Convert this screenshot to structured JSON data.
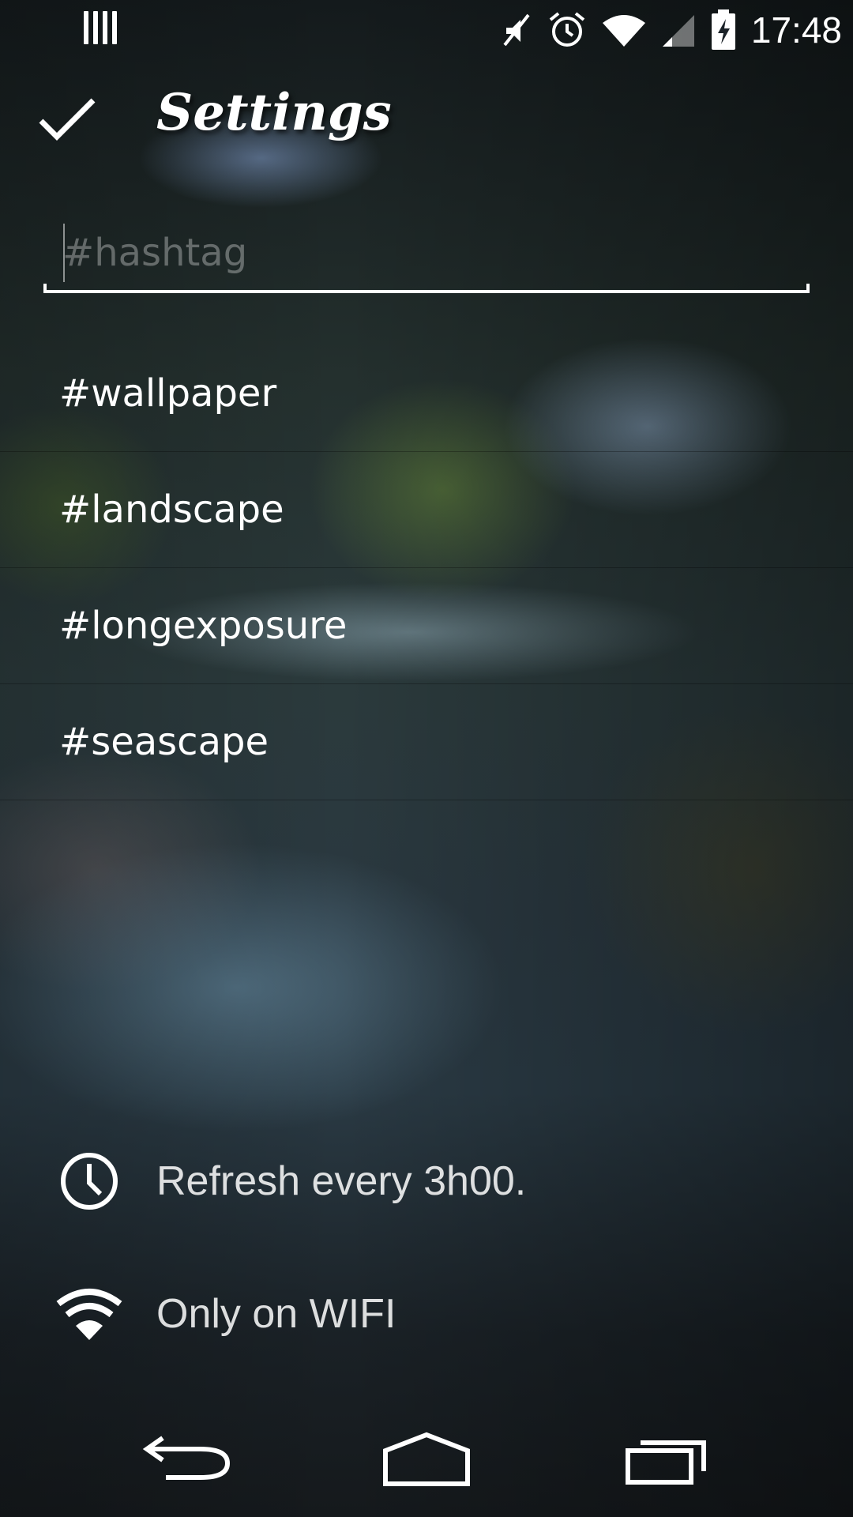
{
  "status_bar": {
    "time": "17:48",
    "icons": [
      "notification-bars-icon",
      "mute-icon",
      "alarm-icon",
      "wifi-icon",
      "signal-icon",
      "battery-charging-icon"
    ]
  },
  "action_bar": {
    "title": "Settings",
    "confirm_icon": "check-icon"
  },
  "hashtag_input": {
    "placeholder": "#hashtag",
    "value": ""
  },
  "tags": [
    {
      "label": "#wallpaper"
    },
    {
      "label": "#landscape"
    },
    {
      "label": "#longexposure"
    },
    {
      "label": "#seascape"
    }
  ],
  "options": {
    "refresh": {
      "label": "Refresh every 3h00.",
      "icon": "clock-icon"
    },
    "wifi": {
      "label": "Only on WIFI",
      "icon": "wifi-icon"
    }
  },
  "nav_bar": {
    "buttons": [
      "back-icon",
      "home-icon",
      "recents-icon"
    ]
  }
}
